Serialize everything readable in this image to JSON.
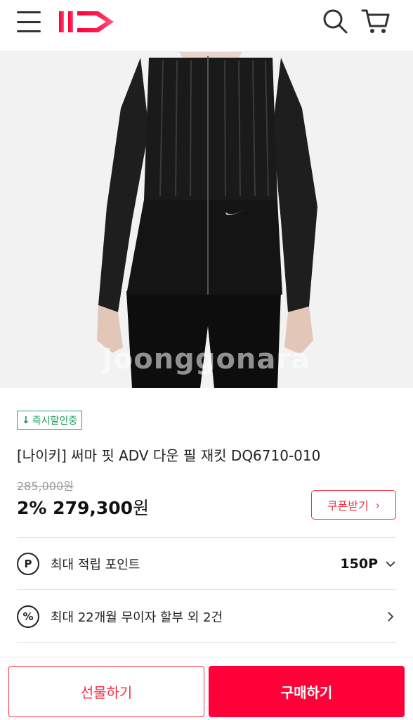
{
  "header": {
    "logo_text": "11",
    "brand_color": "#ff0038"
  },
  "hero": {
    "watermark": "Joonggonara"
  },
  "product": {
    "badge_arrow": "↓",
    "badge_label": "즉시할인중",
    "title": "[나이키] 써마 핏 ADV 다운 필 재킷 DQ6710-010",
    "original_price": "285,000원",
    "discount": "2%",
    "price": "279,300",
    "price_unit": "원",
    "coupon_label": "쿠폰받기"
  },
  "info_rows": {
    "points_icon": "P",
    "points_label": "최대 적립 포인트",
    "points_value": "150P",
    "installment_icon": "%",
    "installment_label": "최대 22개월 무이자 할부 외 2건"
  },
  "bottom_bar": {
    "gift_label": "선물하기",
    "buy_label": "구매하기"
  },
  "icons": {
    "menu": "hamburger-icon",
    "search": "search-icon",
    "cart": "cart-icon"
  }
}
